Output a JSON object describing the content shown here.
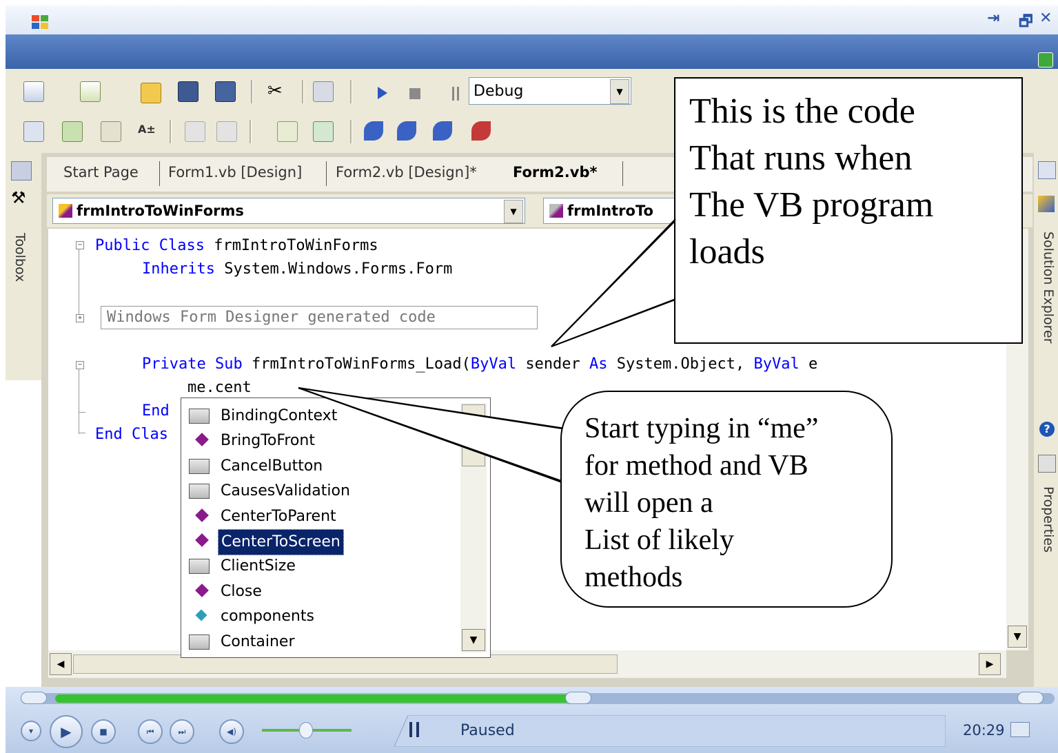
{
  "window": {
    "controls": {
      "pin": "⇥",
      "restore": "🗗",
      "close": "✕"
    }
  },
  "toolbar": {
    "configuration_value": "Debug",
    "icons": [
      "new-project-icon",
      "add-item-icon",
      "open-icon",
      "save-icon",
      "save-all-icon",
      "cut-icon",
      "copy-icon",
      "start-icon",
      "stop-icon",
      "pause-icon"
    ]
  },
  "left_panel": {
    "toolbox_label": "Toolbox"
  },
  "right_panel": {
    "solution_explorer_label": "Solution Explorer",
    "properties_label": "Properties"
  },
  "tabs": [
    {
      "label": "Start Page"
    },
    {
      "label": "Form1.vb [Design]"
    },
    {
      "label": "Form2.vb [Design]*"
    },
    {
      "label": "Form2.vb*",
      "active": true
    }
  ],
  "navbar": {
    "class_select": "frmIntroToWinForms",
    "member_select": "frmIntroTo"
  },
  "code": {
    "line1_kw": "Public Class",
    "line1_rest": " frmIntroToWinForms",
    "line2_kw": "Inherits",
    "line2_rest": " System.Windows.Forms.Form",
    "region": "Windows Form Designer generated code",
    "line4_kw1": "Private Sub",
    "line4_mid": " frmIntroToWinForms_Load(",
    "line4_kw2": "ByVal",
    "line4_mid2": " sender ",
    "line4_kw3": "As",
    "line4_mid3": " System.Object, ",
    "line4_kw4": "ByVal",
    "line4_end": " e",
    "line5": "me.cent",
    "line6_kw": "End",
    "line7_kw": "End Clas"
  },
  "intellisense": {
    "items": [
      {
        "label": "BindingContext",
        "icon": "property-icon"
      },
      {
        "label": "BringToFront",
        "icon": "method-icon"
      },
      {
        "label": "CancelButton",
        "icon": "property-icon"
      },
      {
        "label": "CausesValidation",
        "icon": "property-icon"
      },
      {
        "label": "CenterToParent",
        "icon": "method-icon"
      },
      {
        "label": "CenterToScreen",
        "icon": "method-icon",
        "selected": true
      },
      {
        "label": "ClientSize",
        "icon": "property-icon"
      },
      {
        "label": "Close",
        "icon": "method-icon"
      },
      {
        "label": "components",
        "icon": "field-icon"
      },
      {
        "label": "Container",
        "icon": "property-icon"
      }
    ]
  },
  "callouts": {
    "load_code": "This is the code\nThat runs when\nThe VB program\nloads",
    "intellisense_tip": "Start typing in “me”\nfor method and VB\nwill open a\nList of likely\nmethods"
  },
  "media_player": {
    "status": "Paused",
    "time": "20:29",
    "progress_fraction": 0.5,
    "volume_fraction": 0.5
  }
}
